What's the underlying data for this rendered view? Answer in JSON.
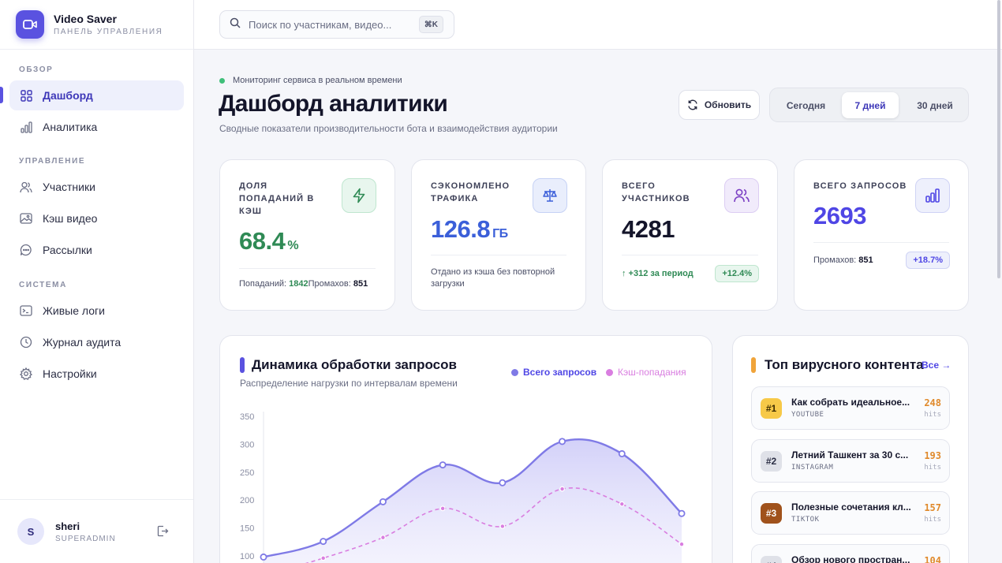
{
  "brand": {
    "name": "Video Saver",
    "subtitle": "ПАНЕЛЬ УПРАВЛЕНИЯ"
  },
  "nav": {
    "sections": [
      "ОБЗОР",
      "УПРАВЛЕНИЕ",
      "СИСТЕМА"
    ],
    "items": [
      {
        "label": "Дашборд",
        "icon": "grid-icon",
        "active": true
      },
      {
        "label": "Аналитика",
        "icon": "bar-chart-icon",
        "active": false
      },
      {
        "label": "Участники",
        "icon": "users-icon",
        "active": false
      },
      {
        "label": "Кэш видео",
        "icon": "image-icon",
        "active": false
      },
      {
        "label": "Рассылки",
        "icon": "chat-icon",
        "active": false
      },
      {
        "label": "Живые логи",
        "icon": "terminal-icon",
        "active": false
      },
      {
        "label": "Журнал аудита",
        "icon": "clock-icon",
        "active": false
      },
      {
        "label": "Настройки",
        "icon": "gear-icon",
        "active": false
      }
    ]
  },
  "user": {
    "initial": "S",
    "name": "sheri",
    "role": "SUPERADMIN"
  },
  "search": {
    "placeholder": "Поиск по участникам, видео...",
    "shortcut": "⌘K"
  },
  "header": {
    "live_text": "Мониторинг сервиса в реальном времени",
    "title": "Дашборд аналитики",
    "subtitle": "Сводные показатели производительности бота и взаимодействия аудитории",
    "refresh_label": "Обновить",
    "periods": [
      "Сегодня",
      "7 дней",
      "30 дней"
    ],
    "active_period": "7 дней"
  },
  "stats": {
    "cache": {
      "label": "ДОЛЯ ПОПАДАНИЙ В КЭШ",
      "value": "68.4",
      "unit": "%",
      "hits_label": "Попаданий:",
      "hits": "1842",
      "misses_label": "Промахов:",
      "misses": "851",
      "icon": "lightning-icon",
      "color": "#2f8a55"
    },
    "traffic": {
      "label": "СЭКОНОМЛЕНО ТРАФИКА",
      "value": "126.8",
      "unit": "ГБ",
      "note": "Отдано из кэша без повторной загрузки",
      "icon": "scales-icon",
      "color": "#3b5fd9"
    },
    "members": {
      "label": "ВСЕГО УЧАСТНИКОВ",
      "value": "4281",
      "delta": "↑ +312 за период",
      "badge": "+12.4%",
      "icon": "users-icon",
      "color": "#14152a"
    },
    "requests": {
      "label": "ВСЕГО ЗАПРОСОВ",
      "value": "2693",
      "misses_label": "Промахов:",
      "misses": "851",
      "badge": "+18.7%",
      "icon": "bar-chart-icon",
      "color": "#4f46e5"
    }
  },
  "chart_section": {
    "title": "Динамика обработки запросов",
    "subtitle": "Распределение нагрузки по интервалам времени"
  },
  "chart_data": {
    "type": "area",
    "yticks": [
      100,
      150,
      200,
      250,
      300,
      350
    ],
    "ylim": [
      90,
      350
    ],
    "series": [
      {
        "name": "Всего запросов",
        "color": "#7f7ae6",
        "values": [
          98,
          126,
          197,
          263,
          231,
          305,
          283,
          176
        ]
      },
      {
        "name": "Кэш-попадания",
        "color": "#d97ee0",
        "values": [
          65,
          96,
          133,
          185,
          153,
          220,
          193,
          121
        ]
      }
    ]
  },
  "viral": {
    "title": "Топ вирусного контента",
    "all_link": "Все →",
    "items": [
      {
        "rank": "#1",
        "title": "Как собрать идеальное...",
        "source": "YOUTUBE",
        "hits": "248",
        "hits_label": "hits",
        "rank_bg": "#f7c948",
        "rank_fg": "#3b2b00"
      },
      {
        "rank": "#2",
        "title": "Летний Ташкент за 30 с...",
        "source": "INSTAGRAM",
        "hits": "193",
        "hits_label": "hits",
        "rank_bg": "#dfe1e8",
        "rank_fg": "#2b2e44"
      },
      {
        "rank": "#3",
        "title": "Полезные сочетания кл...",
        "source": "TIKTOK",
        "hits": "157",
        "hits_label": "hits",
        "rank_bg": "#a0521c",
        "rank_fg": "#ffffff"
      },
      {
        "rank": "#4",
        "title": "Обзор нового простран...",
        "source": "",
        "hits": "104",
        "hits_label": "",
        "rank_bg": "#dfe1e8",
        "rank_fg": "#2b2e44"
      }
    ]
  }
}
